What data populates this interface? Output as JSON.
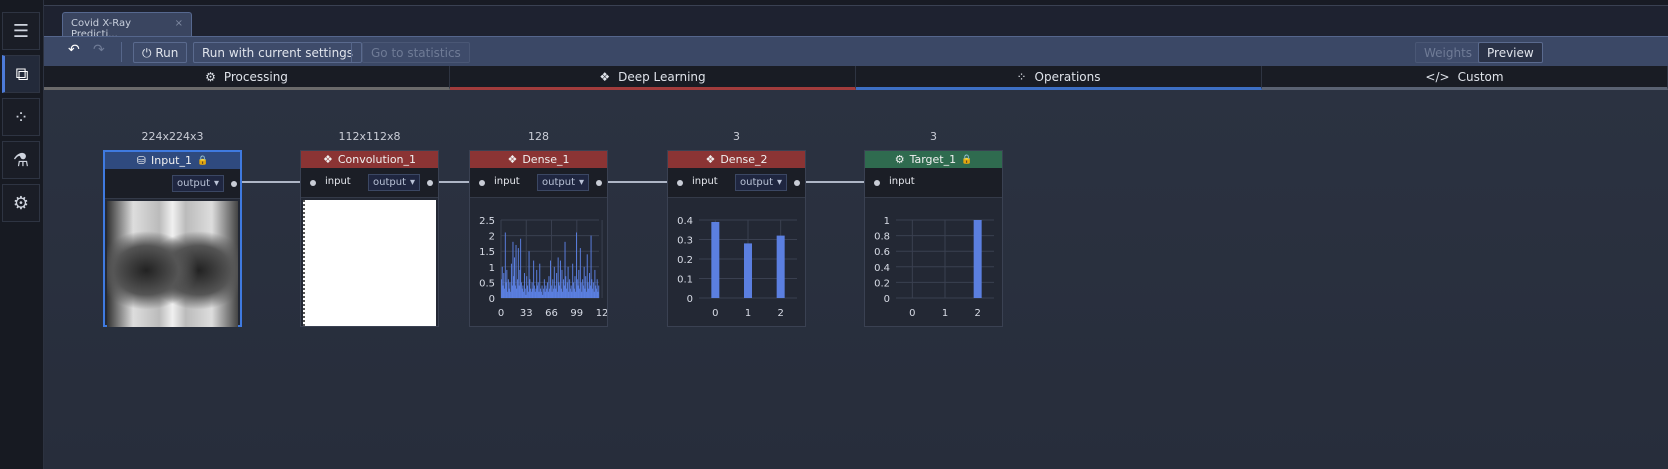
{
  "app": {
    "doc_tab": "Covid X-Ray Predicti...",
    "doc_tab_close": "×"
  },
  "sidebar": {
    "items": [
      {
        "icon": "model-list-icon"
      },
      {
        "icon": "model-graph-icon",
        "active": true
      },
      {
        "icon": "statistics-icon"
      },
      {
        "icon": "flask-icon"
      },
      {
        "icon": "gear-icon"
      }
    ]
  },
  "toolbar": {
    "undo": "↶",
    "redo": "↷",
    "run": "Run",
    "run_current": "Run with current settings",
    "go_stats": "Go to statistics",
    "weights": "Weights",
    "preview": "Preview"
  },
  "categories": [
    {
      "label": "Processing",
      "icon": "gear-icon",
      "color": "#6b6a6a"
    },
    {
      "label": "Deep Learning",
      "icon": "layers-icon",
      "color": "#a13c3c"
    },
    {
      "label": "Operations",
      "icon": "grid-icon",
      "color": "#3d6fc4"
    },
    {
      "label": "Custom",
      "icon": "code-icon",
      "color": "#5a6272"
    }
  ],
  "nodes": [
    {
      "name": "Input_1",
      "shape": "224x224x3",
      "header_color": "#2f4a7e",
      "icon": "database-icon",
      "locked": true,
      "input": "",
      "output": "output",
      "preview": "xray-image"
    },
    {
      "name": "Convolution_1",
      "shape": "112x112x8",
      "header_color": "#8b3434",
      "icon": "layers-icon",
      "input": "input",
      "output": "output",
      "preview": "feature-map"
    },
    {
      "name": "Dense_1",
      "shape": "128",
      "header_color": "#8b3434",
      "icon": "layers-icon",
      "input": "input",
      "output": "output",
      "preview": "chart"
    },
    {
      "name": "Dense_2",
      "shape": "3",
      "header_color": "#8b3434",
      "icon": "layers-icon",
      "input": "input",
      "output": "output",
      "preview": "chart"
    },
    {
      "name": "Target_1",
      "shape": "3",
      "header_color": "#2f6b4f",
      "icon": "target-icon",
      "locked": true,
      "input": "input",
      "output": "",
      "preview": "chart"
    }
  ],
  "chart_data": [
    {
      "node": "Dense_1",
      "type": "bar",
      "ylim": [
        0,
        2.5
      ],
      "yticks": [
        "2.5",
        "2",
        "1.5",
        "1",
        "0.5",
        "0"
      ],
      "xticks": [
        "0",
        "33",
        "66",
        "99",
        "12"
      ],
      "xlim": [
        0,
        128
      ],
      "color": "#5b7fe0",
      "values": [
        0.6,
        1.0,
        0.4,
        0.8,
        0.3,
        2.1,
        0.5,
        0.9,
        0.2,
        0.6,
        0.3,
        0.5,
        0.2,
        1.1,
        0.4,
        1.8,
        0.7,
        1.3,
        0.4,
        1.7,
        0.3,
        0.6,
        1.6,
        0.4,
        0.9,
        1.9,
        0.5,
        0.3,
        0.4,
        0.2,
        0.8,
        0.3,
        0.1,
        0.7,
        0.4,
        0.2,
        1.5,
        0.6,
        0.3,
        0.2,
        0.5,
        0.3,
        1.2,
        0.4,
        0.2,
        0.3,
        0.9,
        0.4,
        0.5,
        0.2,
        1.1,
        0.3,
        0.2,
        0.4,
        0.1,
        0.3,
        0.6,
        0.2,
        0.4,
        0.3,
        0.5,
        0.2,
        0.7,
        0.3,
        1.2,
        0.4,
        0.2,
        0.6,
        0.3,
        1.0,
        0.4,
        0.3,
        0.8,
        0.2,
        1.3,
        0.5,
        0.4,
        1.2,
        0.3,
        0.9,
        0.2,
        0.6,
        0.4,
        1.8,
        0.7,
        0.3,
        0.5,
        1.0,
        0.2,
        0.6,
        0.3,
        0.4,
        0.2,
        1.1,
        0.5,
        0.3,
        0.7,
        0.2,
        2.1,
        0.6,
        0.4,
        0.9,
        0.3,
        1.6,
        0.5,
        0.2,
        0.6,
        0.4,
        1.0,
        0.3,
        0.7,
        0.2,
        1.4,
        0.5,
        0.3,
        0.8,
        0.4,
        2.0,
        0.6,
        0.3,
        0.5,
        0.2,
        0.9,
        0.4,
        0.3,
        0.6,
        0.2,
        0.4
      ]
    },
    {
      "node": "Dense_2",
      "type": "bar",
      "ylim": [
        0,
        0.4
      ],
      "yticks": [
        "0.4",
        "0.3",
        "0.2",
        "0.1",
        "0"
      ],
      "categories": [
        "0",
        "1",
        "2"
      ],
      "values": [
        0.39,
        0.28,
        0.32
      ],
      "color": "#5b7fe0"
    },
    {
      "node": "Target_1",
      "type": "bar",
      "ylim": [
        0,
        1
      ],
      "yticks": [
        "1",
        "0.8",
        "0.6",
        "0.4",
        "0.2",
        "0"
      ],
      "categories": [
        "0",
        "1",
        "2"
      ],
      "values": [
        0,
        0,
        1
      ],
      "color": "#5b7fe0"
    }
  ]
}
